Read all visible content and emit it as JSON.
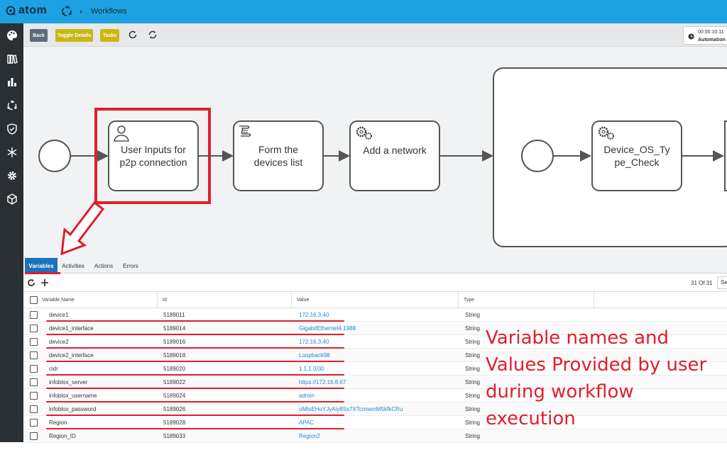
{
  "app": {
    "logo_text": "atom",
    "breadcrumb": "Workflows"
  },
  "toolbar": {
    "back_label": "Back",
    "toggle_details_label": "Toggle Details",
    "tasks_label": "Tasks",
    "timer_time": "00:00:10.11",
    "timer_label": "Automation"
  },
  "diagram": {
    "tasks": [
      {
        "line1": "User Inputs for",
        "line2": "p2p connection"
      },
      {
        "line1": "Form the",
        "line2": "devices list"
      },
      {
        "line1": "Add a network",
        "line2": ""
      },
      {
        "line1": "Device_OS_Ty",
        "line2": "pe_Check"
      }
    ]
  },
  "tabs": [
    "Variables",
    "Activities",
    "Actions",
    "Errors"
  ],
  "table": {
    "count": "31 Of 31",
    "search_placeholder": "Se",
    "columns": [
      "Variable Name",
      "Id",
      "Value",
      "Type"
    ],
    "rows": [
      {
        "name": "device1",
        "id": "5189011",
        "value": "172.16.3.40",
        "type": "String"
      },
      {
        "name": "device1_interface",
        "id": "5189014",
        "value": "GigabitEthernet4.1988",
        "type": "String"
      },
      {
        "name": "device2",
        "id": "5189016",
        "value": "172.16.3.40",
        "type": "String"
      },
      {
        "name": "device2_interface",
        "id": "5189018",
        "value": "Loopback98",
        "type": "String"
      },
      {
        "name": "cidr",
        "id": "5189020",
        "value": "1.1.1.0/30",
        "type": "String"
      },
      {
        "name": "infoblox_server",
        "id": "5189022",
        "value": "https://172.16.8.67",
        "type": "String"
      },
      {
        "name": "infoblox_username",
        "id": "5189024",
        "value": "admin",
        "type": "String"
      },
      {
        "name": "infoblox_password",
        "id": "5189026",
        "value": "oMtsEHoYJyAiy8Ss7XTcnnemM5kfkCRu",
        "type": "String"
      },
      {
        "name": "Region",
        "id": "5189028",
        "value": "APAC",
        "type": "String"
      },
      {
        "name": "Region_ID",
        "id": "5189033",
        "value": "Region2",
        "type": "String"
      }
    ]
  },
  "annotation": {
    "lines": [
      "Variable names and",
      "Values Provided by user",
      "during workflow",
      "execution"
    ]
  },
  "colors": {
    "topbar": "#1ea1e3",
    "sidebar": "#2a2f33",
    "accent": "#e01e2b",
    "active_tab": "#1b72b8",
    "yellow_btn": "#c8b814"
  }
}
